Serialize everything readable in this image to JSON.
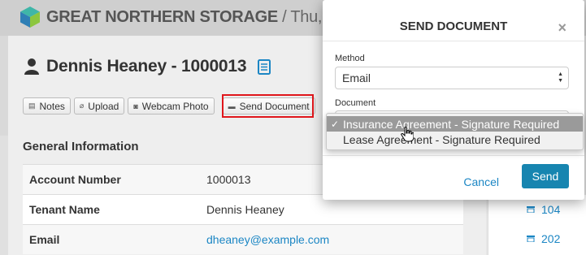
{
  "header": {
    "brand": "GREAT NORTHERN STORAGE",
    "separator": " / ",
    "date_fragment": "Thu, J"
  },
  "tenant": {
    "name": "Dennis Heaney - 1000013"
  },
  "toolbar": {
    "notes_label": "Notes",
    "upload_label": "Upload",
    "webcam_label": "Webcam Photo",
    "send_document_label": "Send Document"
  },
  "general_info": {
    "title": "General Information",
    "rows": [
      {
        "key": "Account Number",
        "value": "1000013"
      },
      {
        "key": "Tenant Name",
        "value": "Dennis Heaney"
      },
      {
        "key": "Email",
        "value": "dheaney@example.com"
      }
    ]
  },
  "units": [
    {
      "label": "104"
    },
    {
      "label": "202"
    }
  ],
  "modal": {
    "title": "SEND DOCUMENT",
    "close": "×",
    "method_label": "Method",
    "method_value": "Email",
    "document_label": "Document",
    "cancel_label": "Cancel",
    "send_label": "Send"
  },
  "dropdown": {
    "options": [
      {
        "label": "Insurance Agreement - Signature Required",
        "selected": true
      },
      {
        "label": "Lease Agreement - Signature Required",
        "selected": false
      }
    ],
    "check": "✓"
  },
  "colors": {
    "link": "#1b86c4",
    "primary_button": "#1785b0",
    "highlight_box": "#e0161b"
  },
  "icons": [
    "logo-icon",
    "person-icon",
    "document-list-icon",
    "notes-icon",
    "paperclip-icon",
    "camera-icon",
    "folder-icon",
    "close-icon",
    "select-arrows-icon",
    "checkmark-icon",
    "unit-icon",
    "hand-cursor-icon"
  ]
}
